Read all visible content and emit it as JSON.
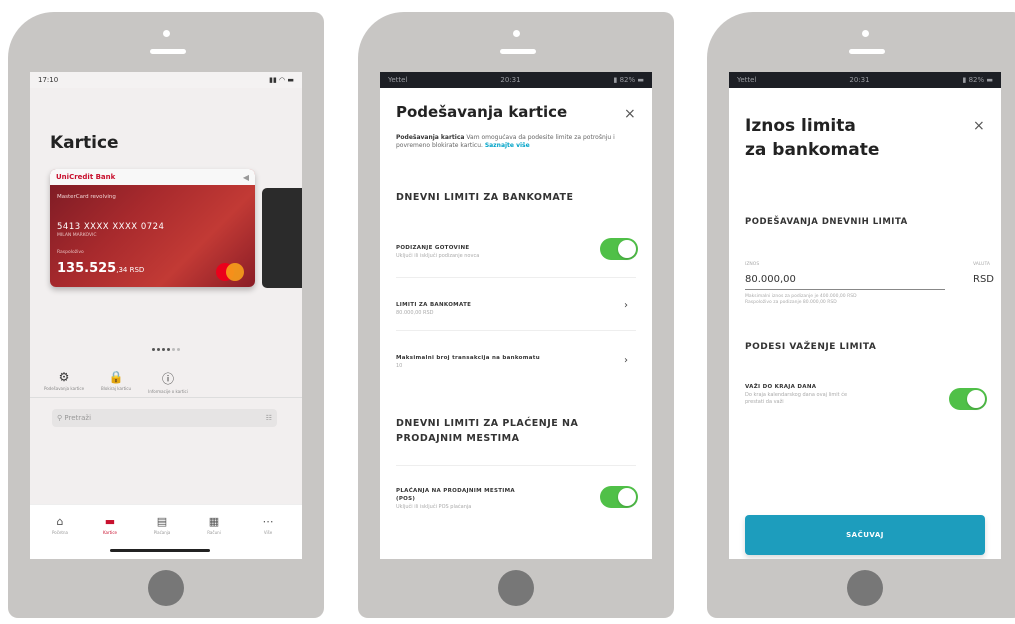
{
  "phone1": {
    "status": {
      "time": "17:10",
      "icons": "▮▮ ◠ ▬"
    },
    "title": "Kartice",
    "card": {
      "bank": "UniCredit Bank",
      "type": "MasterCard revolving",
      "number": "5413 XXXX XXXX 0724",
      "small": "MILAN MARKOVIC",
      "available_label": "Raspoloživo",
      "balance_main": "135.525",
      "balance_dec": ",34 RSD"
    },
    "quick_actions": [
      {
        "icon": "⚙",
        "label": "Podešavanja kartice"
      },
      {
        "icon": "🔒",
        "label": "Blokiraj karticu"
      },
      {
        "icon": "ⓘ",
        "label": "Informacije o kartici"
      }
    ],
    "search": {
      "placeholder": "Pretraži",
      "filter_icon": "☷"
    },
    "tabs": [
      {
        "icon": "⌂",
        "label": "Početna"
      },
      {
        "icon": "▬",
        "label": "Kartice"
      },
      {
        "icon": "▤",
        "label": "Plaćanja"
      },
      {
        "icon": "▦",
        "label": "Računi"
      },
      {
        "icon": "⋯",
        "label": "Više"
      }
    ]
  },
  "phone2": {
    "status": {
      "carrier": "Yettel",
      "time": "20:31",
      "battery": "▮ 82% ▬"
    },
    "title": "Podešavanja kartice",
    "close": "×",
    "intro_bold": "Podešavanja kartica",
    "intro_text": " Vam omogućava da podesite limite za potrošnju i povremeno blokirate karticu. ",
    "intro_link": "Saznajte više",
    "section1": "DNEVNI LIMITI ZA BANKOMATE",
    "row1_title": "PODIZANJE GOTOVINE",
    "row1_sub": "Uključi ili isključi podizanje novca",
    "row2_title": "LIMITI ZA BANKOMATE",
    "row2_sub": "80.000,00 RSD",
    "row3_title": "Maksimalni broj transakcija na bankomatu",
    "row3_sub": "10",
    "chevron": "›",
    "section2_line1": "DNEVNI LIMITI ZA PLAĆENJE NA",
    "section2_line2": "PRODAJNIM MESTIMA",
    "row4_title_line1": "PLAĆANJA NA PRODAJNIM MESTIMA",
    "row4_title_line2": "(POS)",
    "row4_sub": "Uključi ili isključi POS plaćanja"
  },
  "phone3": {
    "status": {
      "carrier": "Yettel",
      "time": "20:31",
      "battery": "▮ 82% ▬"
    },
    "title_line1": "Iznos limita",
    "title_line2": "za bankomate",
    "close": "×",
    "section1": "PODEŠAVANJA DNEVNIH LIMITA",
    "field_label": "IZNOS",
    "field_value": "80.000,00",
    "currency_label": "VALUTA",
    "currency": "RSD",
    "note_line1": "Maksimalni iznos za podizanje je 400.000,00 RSD",
    "note_line2": "Raspoloživo za podizanje 80.000,00 RSD",
    "section2": "PODESI VAŽENJE LIMITA",
    "row_title": "VAŽI DO KRAJA DANA",
    "row_sub_line1": "Do kraja kalendarskog dana ovaj limit će",
    "row_sub_line2": "prestati da važi",
    "save": "SAČUVAJ"
  },
  "colors": {
    "toggle_on": "#50c048",
    "save_button": "#1d9dbd",
    "brand_red": "#c8102e",
    "link": "#00a3c8"
  }
}
